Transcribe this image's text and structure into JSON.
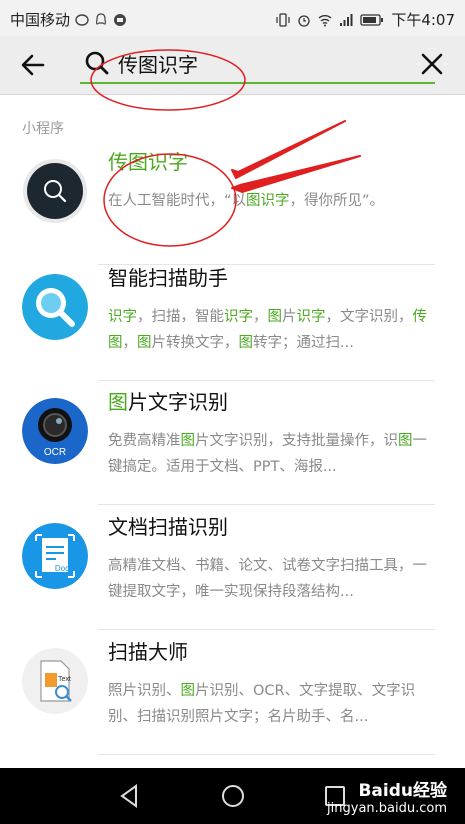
{
  "status_bar": {
    "carrier": "中国移动",
    "time": "下午4:07"
  },
  "header": {
    "query": "传图识字"
  },
  "section_label": "小程序",
  "results": [
    {
      "title_parts": [
        {
          "t": "传图识字",
          "hl": true
        }
      ],
      "desc_parts": [
        {
          "t": "在人工智能时代，“以",
          "hl": false
        },
        {
          "t": "图识字",
          "hl": true
        },
        {
          "t": "，得你所见”。",
          "hl": false
        }
      ],
      "icon": "magnifier-dark-icon"
    },
    {
      "title_parts": [
        {
          "t": "智能扫描助手",
          "hl": false
        }
      ],
      "desc_parts": [
        {
          "t": "识字",
          "hl": true
        },
        {
          "t": "，扫描，智能",
          "hl": false
        },
        {
          "t": "识字",
          "hl": true
        },
        {
          "t": "，",
          "hl": false
        },
        {
          "t": "图",
          "hl": true
        },
        {
          "t": "片",
          "hl": false
        },
        {
          "t": "识字",
          "hl": true
        },
        {
          "t": "，文字识别，",
          "hl": false
        },
        {
          "t": "传图",
          "hl": true
        },
        {
          "t": "，",
          "hl": false
        },
        {
          "t": "图",
          "hl": true
        },
        {
          "t": "片转换文字，",
          "hl": false
        },
        {
          "t": "图",
          "hl": true
        },
        {
          "t": "转字；通过扫...",
          "hl": false
        }
      ],
      "icon": "magnifier-blue-icon"
    },
    {
      "title_parts": [
        {
          "t": "图",
          "hl": true
        },
        {
          "t": "片文字识别",
          "hl": false
        }
      ],
      "desc_parts": [
        {
          "t": "免费高精准",
          "hl": false
        },
        {
          "t": "图",
          "hl": true
        },
        {
          "t": "片文字识别，支持批量操作，识",
          "hl": false
        },
        {
          "t": "图",
          "hl": true
        },
        {
          "t": "一键搞定。适用于文档、PPT、海报...",
          "hl": false
        }
      ],
      "icon": "ocr-lens-icon",
      "icon_text": "OCR"
    },
    {
      "title_parts": [
        {
          "t": "文档扫描识别",
          "hl": false
        }
      ],
      "desc_parts": [
        {
          "t": "高精准文档、书籍、论文、试卷文字扫描工具，一键提取文字，唯一实现保持段落结构...",
          "hl": false
        }
      ],
      "icon": "doc-scan-icon",
      "icon_text": "Doc"
    },
    {
      "title_parts": [
        {
          "t": "扫描大师",
          "hl": false
        }
      ],
      "desc_parts": [
        {
          "t": "照片识别、",
          "hl": false
        },
        {
          "t": "图",
          "hl": true
        },
        {
          "t": "片识别、OCR、文字提取、文字识别、扫描识别照片文字；名片助手、名...",
          "hl": false
        }
      ],
      "icon": "text-file-icon",
      "icon_text": "Text"
    }
  ],
  "watermark": {
    "brand": "Baidu经验",
    "url": "jingyan.baidu.com"
  },
  "colors": {
    "highlight": "#4aaa1f",
    "annotation": "#e02020"
  }
}
